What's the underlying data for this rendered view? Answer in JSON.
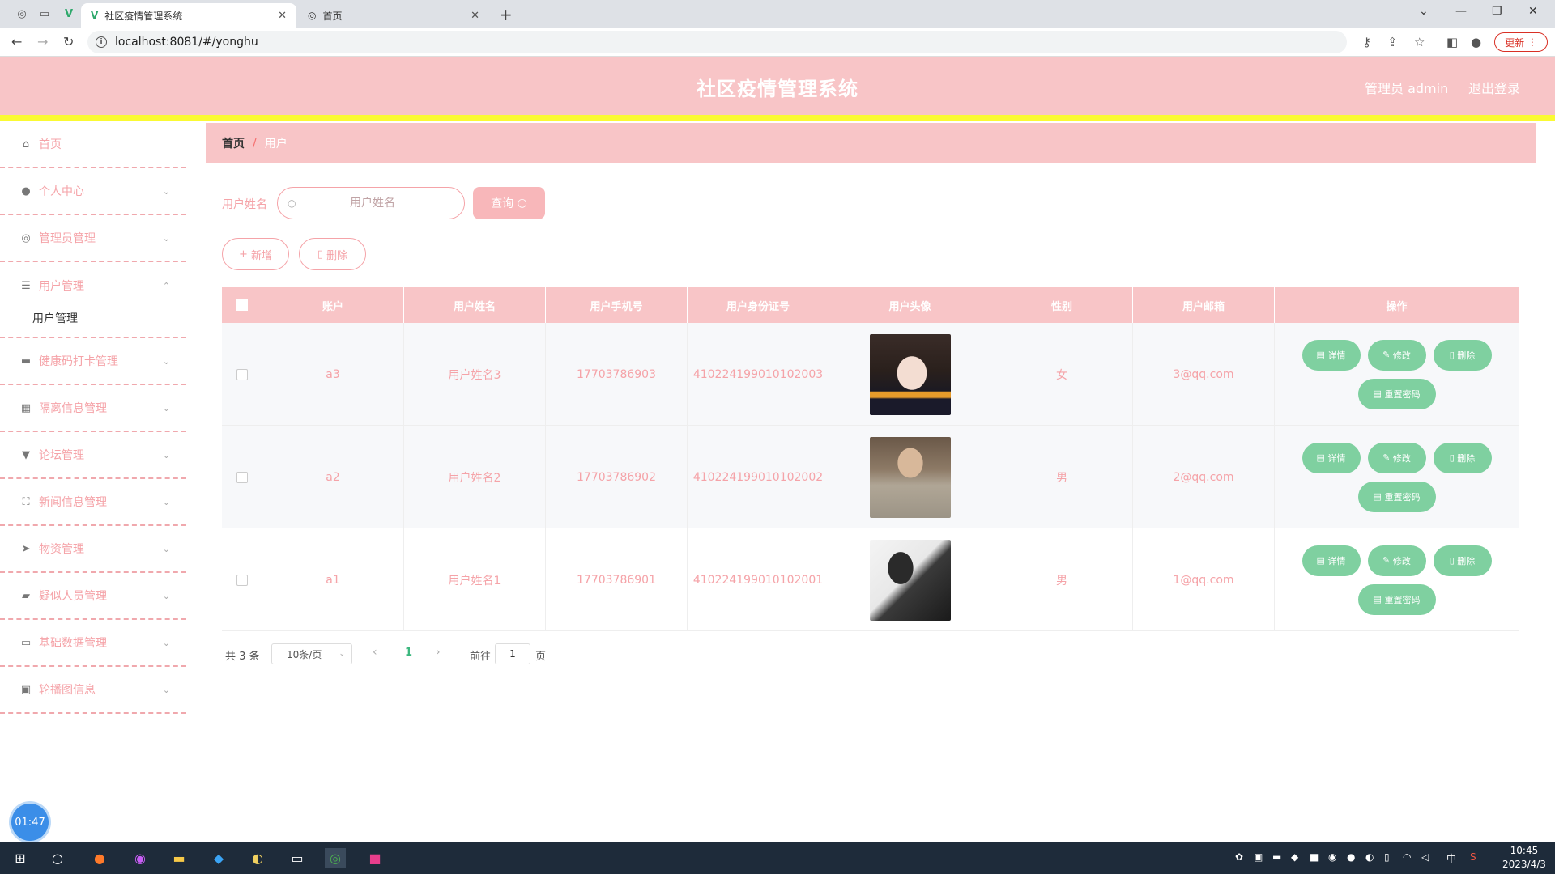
{
  "browser": {
    "tabs": [
      {
        "title": "社区疫情管理系统",
        "active": true
      },
      {
        "title": "首页",
        "active": false
      }
    ],
    "url": "localhost:8081/#/yonghu",
    "update_label": "更新"
  },
  "header": {
    "title": "社区疫情管理系统",
    "admin_label": "管理员 admin",
    "logout_label": "退出登录"
  },
  "sidebar": {
    "items": [
      {
        "label": "首页",
        "icon": "home-icon"
      },
      {
        "label": "个人中心",
        "icon": "user-icon"
      },
      {
        "label": "管理员管理",
        "icon": "settings-icon"
      },
      {
        "label": "用户管理",
        "icon": "sliders-icon",
        "expanded": true,
        "sub": "用户管理"
      },
      {
        "label": "健康码打卡管理",
        "icon": "shop-icon"
      },
      {
        "label": "隔离信息管理",
        "icon": "grid-icon"
      },
      {
        "label": "论坛管理",
        "icon": "brush-icon"
      },
      {
        "label": "新闻信息管理",
        "icon": "fullscreen-icon"
      },
      {
        "label": "物资管理",
        "icon": "send-icon"
      },
      {
        "label": "疑似人员管理",
        "icon": "ticket-icon"
      },
      {
        "label": "基础数据管理",
        "icon": "monitor-icon"
      },
      {
        "label": "轮播图信息",
        "icon": "clipboard-icon"
      }
    ],
    "timer": "01:47"
  },
  "breadcrumb": {
    "home": "首页",
    "separator": "/",
    "current": "用户"
  },
  "search": {
    "label": "用户姓名",
    "placeholder": "用户姓名",
    "button": "查询"
  },
  "actions": {
    "add": "新增",
    "delete": "删除"
  },
  "table": {
    "columns": [
      "账户",
      "用户姓名",
      "用户手机号",
      "用户身份证号",
      "用户头像",
      "性别",
      "用户邮箱",
      "操作"
    ],
    "rows": [
      {
        "account": "a3",
        "name": "用户姓名3",
        "phone": "17703786903",
        "id_no": "410224199010102003",
        "gender": "女",
        "email": "3@qq.com"
      },
      {
        "account": "a2",
        "name": "用户姓名2",
        "phone": "17703786902",
        "id_no": "410224199010102002",
        "gender": "男",
        "email": "2@qq.com"
      },
      {
        "account": "a1",
        "name": "用户姓名1",
        "phone": "17703786901",
        "id_no": "410224199010102001",
        "gender": "男",
        "email": "1@qq.com"
      }
    ],
    "row_actions": {
      "detail": "详情",
      "edit": "修改",
      "delete": "删除",
      "reset": "重置密码"
    }
  },
  "pagination": {
    "total": "共 3 条",
    "page_size": "10条/页",
    "current_page": "1",
    "goto_label": "前往",
    "goto_value": "1",
    "page_suffix": "页"
  },
  "taskbar": {
    "time": "10:45",
    "date": "2023/4/3",
    "ime": "中"
  },
  "colors": {
    "header_pink": "#f8c5c7",
    "accent_yellow": "#fafa33",
    "text_pink": "#f5a3a8",
    "action_green": "#7fd0a0",
    "page_active": "#3bb77e"
  }
}
